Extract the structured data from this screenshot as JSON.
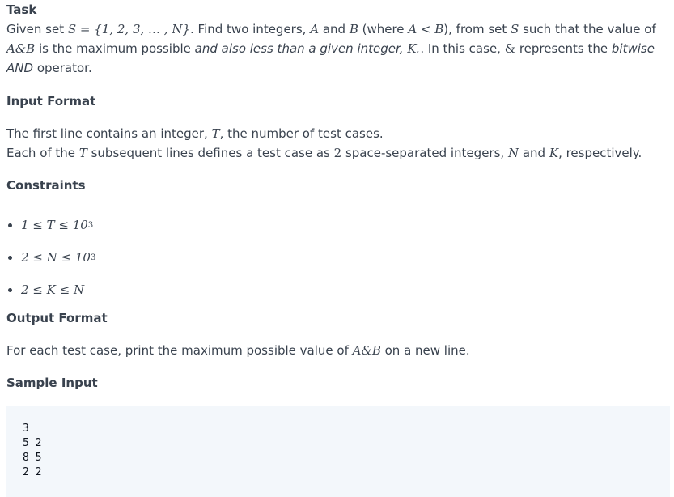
{
  "task": {
    "heading": "Task",
    "p1_a": "Given set ",
    "set_expr": "S = {1, 2, 3, … , N}",
    "p1_b": ". Find two integers, ",
    "A": "A",
    "and1": " and ",
    "B": "B",
    "where_open": " (where ",
    "cond": "A < B",
    "where_close": "), from set ",
    "S": "S",
    "p1_c": " such that the value of ",
    "AandB": "A&B",
    "p1_d": " is the maximum possible ",
    "p1_em": "and also less than a given integer, ",
    "K": "K",
    "p1_e": ". In this case, ",
    "amp": "&",
    "p1_f": " represents the ",
    "p1_em2": "bitwise AND",
    "p1_g": " operator."
  },
  "input_format": {
    "heading": "Input Format",
    "line1_a": "The first line contains an integer, ",
    "T": "T",
    "line1_b": ", the number of test cases.",
    "line2_a": "Each of the ",
    "line2_b": " subsequent lines defines a test case as ",
    "two": "2",
    "line2_c": " space-separated integers, ",
    "N": "N",
    "line2_d": " and ",
    "line2_e": ", respectively."
  },
  "constraints": {
    "heading": "Constraints",
    "items": [
      "1 ≤ T ≤ 10",
      "2 ≤ N ≤ 10",
      "2 ≤ K ≤ N"
    ],
    "sup": "3"
  },
  "output_format": {
    "heading": "Output Format",
    "line_a": "For each test case, print the maximum possible value of ",
    "line_b": " on a new line."
  },
  "sample_input": {
    "heading": "Sample Input",
    "lines": [
      "3",
      "5 2",
      "8 5",
      "2 2"
    ]
  }
}
